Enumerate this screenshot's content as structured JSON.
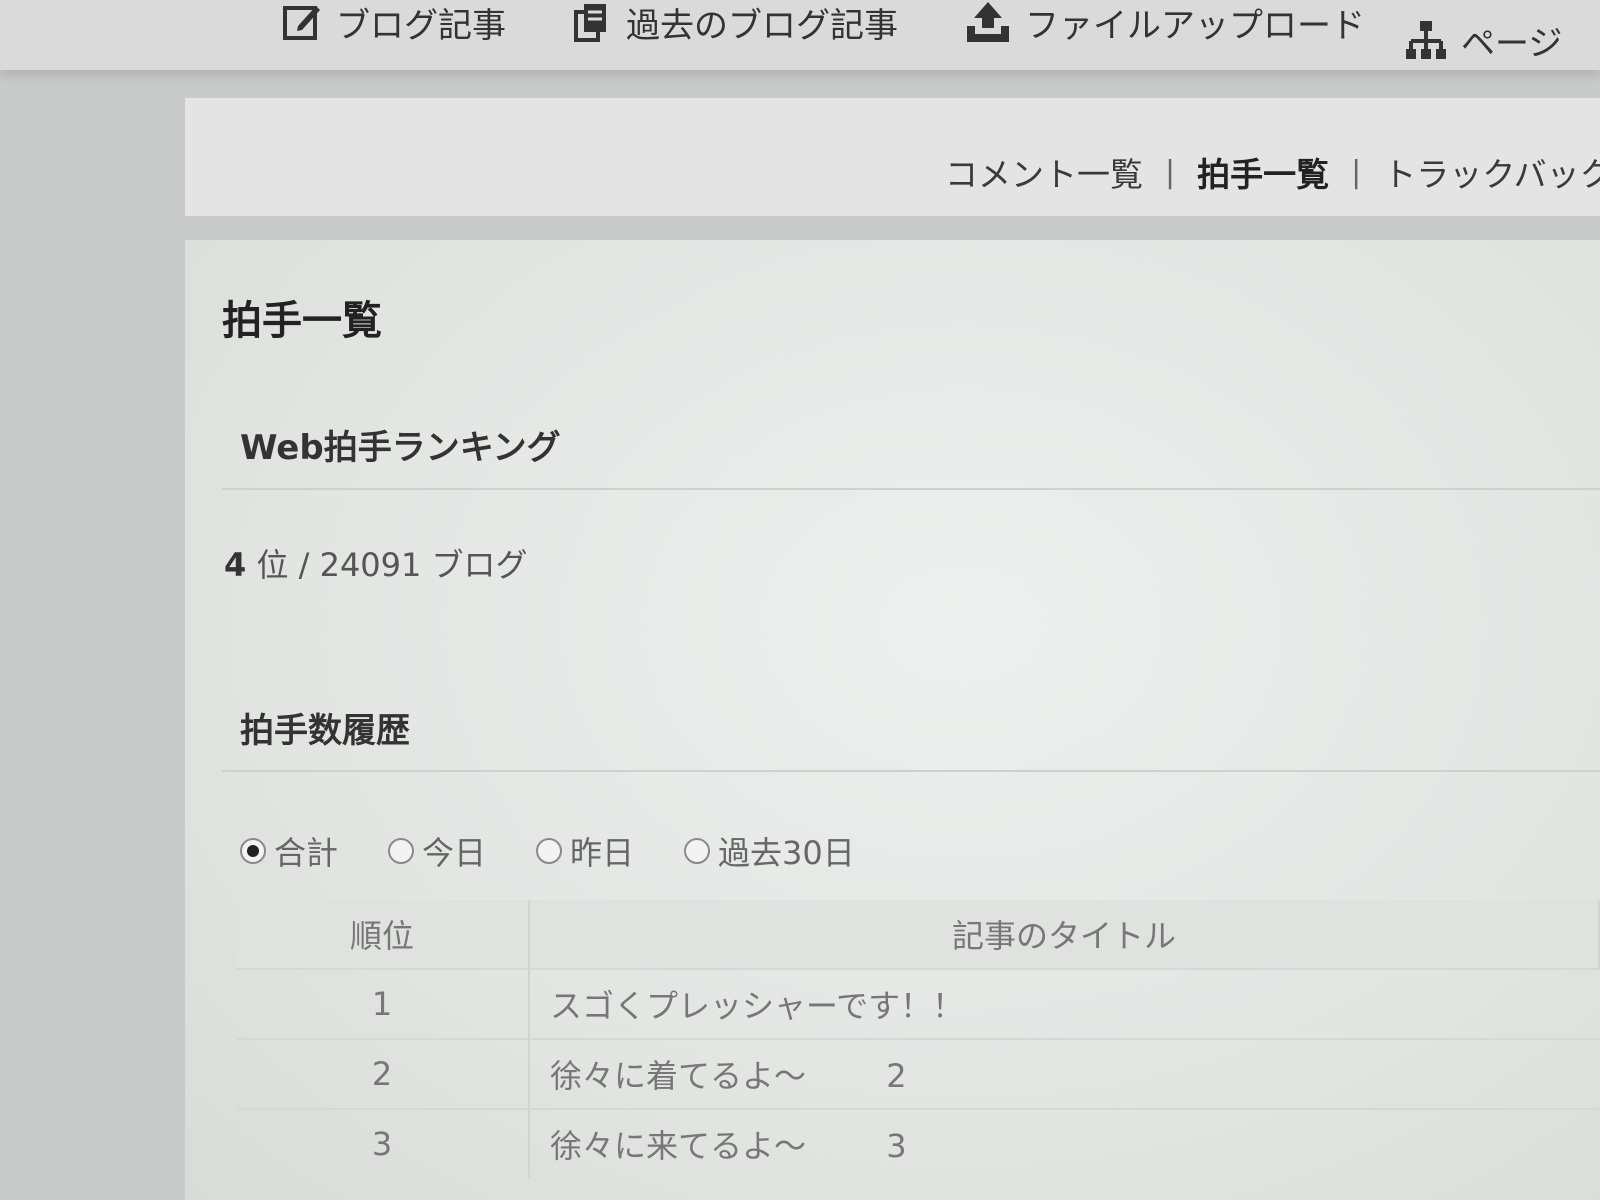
{
  "topnav": {
    "items": [
      {
        "label": "ブログ記事",
        "icon": "edit-icon"
      },
      {
        "label": "過去のブログ記事",
        "icon": "documents-icon"
      },
      {
        "label": "ファイルアップロード",
        "icon": "upload-icon"
      },
      {
        "label": "ページ",
        "icon": "sitemap-icon"
      }
    ]
  },
  "sublinks": {
    "comments": "コメント一覧",
    "claps": "拍手一覧",
    "trackback": "トラックバック",
    "separator": "|"
  },
  "page_title": "拍手一覧",
  "ranking": {
    "heading": "Web拍手ランキング",
    "rank": "4",
    "rank_unit": "位",
    "slash": "/",
    "total": "24091",
    "total_unit": "ブログ"
  },
  "history": {
    "heading": "拍手数履歴",
    "filters": [
      {
        "label": "合計",
        "selected": true
      },
      {
        "label": "今日",
        "selected": false
      },
      {
        "label": "昨日",
        "selected": false
      },
      {
        "label": "過去30日",
        "selected": false
      }
    ],
    "columns": {
      "rank": "順位",
      "title": "記事のタイトル"
    },
    "rows": [
      {
        "rank": "1",
        "title": "スゴくプレッシャーです！！",
        "count": ""
      },
      {
        "rank": "2",
        "title": "徐々に着てるよ～",
        "count": "2"
      },
      {
        "rank": "3",
        "title": "徐々に来てるよ～",
        "count": "3"
      }
    ]
  }
}
